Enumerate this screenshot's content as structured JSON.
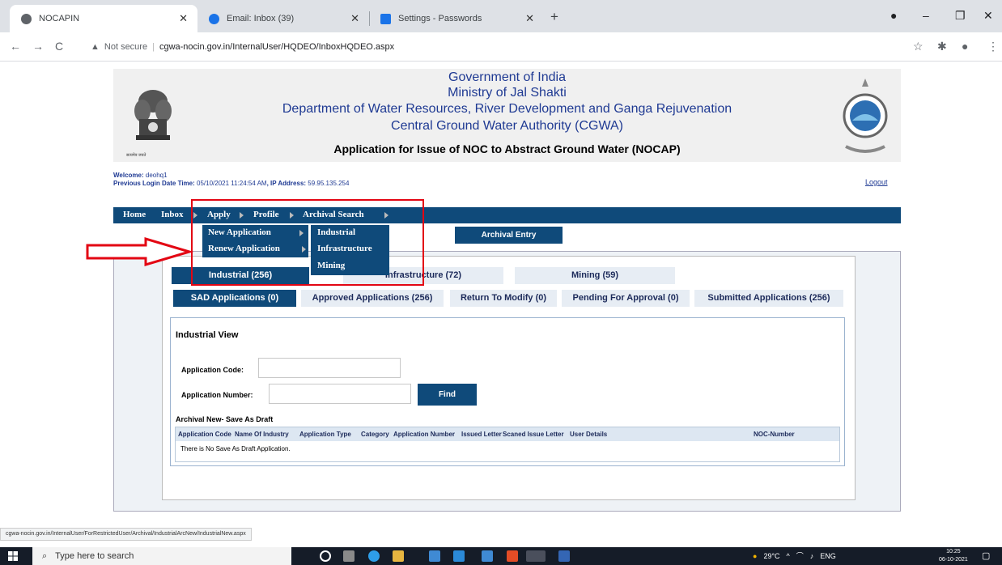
{
  "browser": {
    "tabs": [
      {
        "label": "NOCAPIN",
        "active": true
      },
      {
        "label": "Email: Inbox (39)",
        "active": false
      },
      {
        "label": "Settings - Passwords",
        "active": false
      }
    ],
    "security_label": "Not secure",
    "url": "cgwa-nocin.gov.in/InternalUser/HQDEO/InboxHQDEO.aspx",
    "status_url": "cgwa-nocin.gov.in/InternalUser/ForRestrictedUser/Archival/IndustrialArcNew/IndustrialNew.aspx"
  },
  "header": {
    "line1": "Government of India",
    "line2": "Ministry of Jal Shakti",
    "line3": "Department of Water Resources, River Development and Ganga Rejuvenation",
    "line4": "Central Ground Water Authority (CGWA)",
    "title": "Application for Issue of NOC to Abstract Ground Water (NOCAP)",
    "emblem_caption": "सत्यमेव जयते"
  },
  "welcome": {
    "welcome_label": "Welcome:",
    "user": "deohq1",
    "login_label": "Previous Login Date Time:",
    "login_time": "05/10/2021 11:24:54 AM",
    "ip_label": ", IP Address:",
    "ip": "59.95.135.254",
    "logout": "Logout"
  },
  "nav": {
    "home": "Home",
    "inbox": "Inbox",
    "apply": "Apply",
    "profile": "Profile",
    "archival_search": "Archival Search"
  },
  "apply_menu": {
    "new_application": "New Application",
    "renew_application": "Renew Application",
    "submenu": [
      "Industrial",
      "Infrastructure",
      "Mining"
    ]
  },
  "archival_entry": "Archival Entry",
  "category_tabs": [
    {
      "label": "Industrial (256)",
      "active": true
    },
    {
      "label": "Infrastructure (72)",
      "active": false
    },
    {
      "label": "Mining (59)",
      "active": false
    }
  ],
  "sub_tabs": [
    {
      "label": "SAD Applications (0)",
      "active": true
    },
    {
      "label": "Approved Applications (256)",
      "active": false
    },
    {
      "label": "Return To Modify (0)",
      "active": false
    },
    {
      "label": "Pending For Approval (0)",
      "active": false
    },
    {
      "label": "Submitted Applications (256)",
      "active": false
    }
  ],
  "view": {
    "title": "Industrial View",
    "app_code_label": "Application Code:",
    "app_code_value": "",
    "app_number_label": "Application Number:",
    "app_number_value": "",
    "find": "Find",
    "archival_caption": "Archival New- Save As Draft",
    "columns": [
      "Application Code",
      "Name Of Industry",
      "Application Type",
      "Category",
      "Application Number",
      "Issued Letter",
      "Scaned Issue Letter",
      "User Details",
      "NOC-Number"
    ],
    "empty_message": "There is No Save As Draft Application."
  },
  "taskbar": {
    "search_placeholder": "Type here to search",
    "weather": "29°C",
    "lang": "ENG",
    "time": "10:25",
    "date": "06-10-2021"
  },
  "colors": {
    "nav_blue": "#0f4a7a",
    "highlight_red": "#e30613",
    "header_text": "#1f3a93"
  }
}
